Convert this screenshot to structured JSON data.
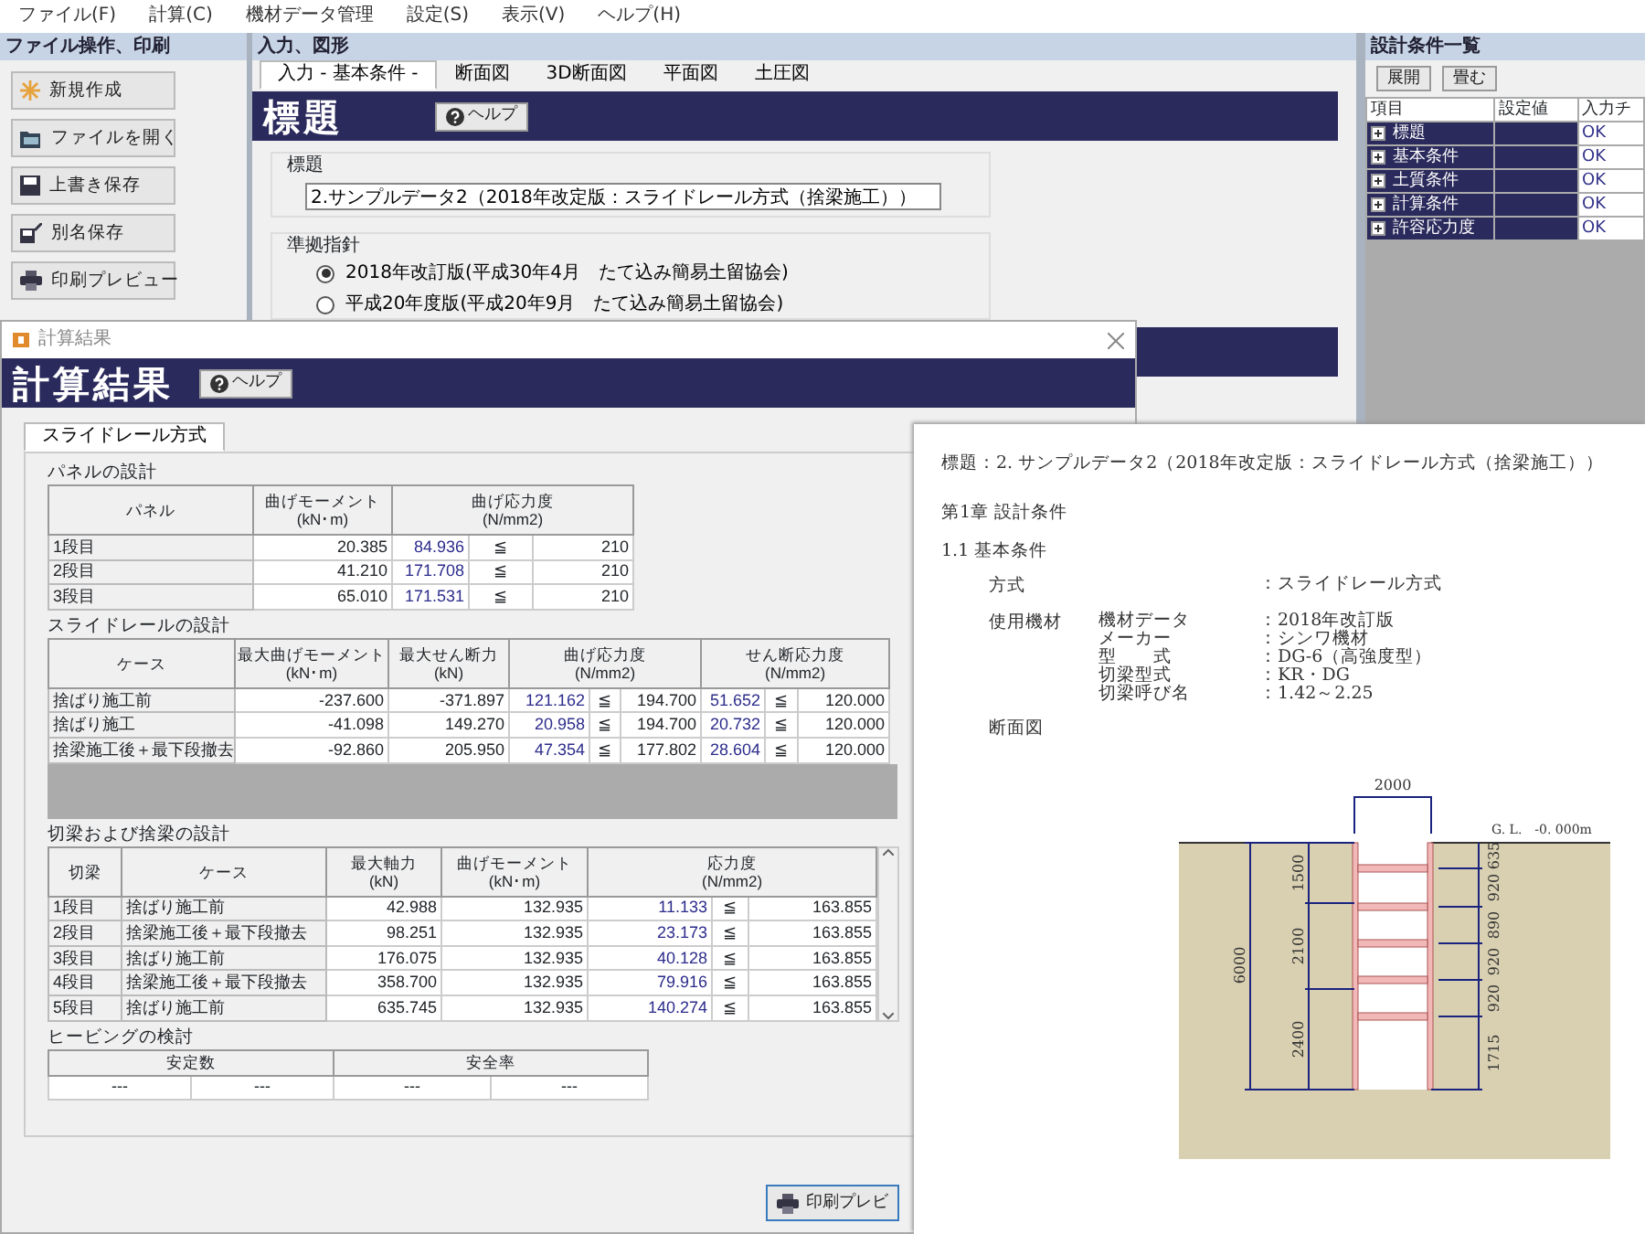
{
  "menu": [
    "ファイル(F)",
    "計算(C)",
    "機材データ管理",
    "設定(S)",
    "表示(V)",
    "ヘルプ(H)"
  ],
  "file_panel": {
    "title": "ファイル操作、印刷",
    "buttons": [
      {
        "label": "新規作成",
        "kind": "new"
      },
      {
        "label": "ファイルを開く",
        "kind": "open"
      },
      {
        "label": "上書き保存",
        "kind": "save"
      },
      {
        "label": "別名保存",
        "kind": "saveas"
      },
      {
        "label": "印刷プレビュー",
        "kind": "print"
      }
    ]
  },
  "input_panel": {
    "title": "入力、図形",
    "tabs": [
      {
        "label": "入力 - 基本条件 -",
        "selected": true
      },
      {
        "label": "断面図",
        "selected": false
      },
      {
        "label": "3D断面図",
        "selected": false
      },
      {
        "label": "平面図",
        "selected": false
      },
      {
        "label": "土圧図",
        "selected": false
      }
    ],
    "banner": {
      "title": "標題",
      "help": "ヘルプ"
    },
    "title_group": {
      "label": "標題",
      "value": "2.サンプルデータ2（2018年改定版：スライドレール方式（捨梁施工））"
    },
    "standard_group": {
      "label": "準拠指針",
      "options": [
        {
          "label": "2018年改訂版(平成30年4月　たて込み簡易土留協会)",
          "selected": true
        },
        {
          "label": "平成20年度版(平成20年9月　たて込み簡易土留協会)",
          "selected": false
        }
      ]
    }
  },
  "conditions_panel": {
    "title": "設計条件一覧",
    "buttons": [
      "展開",
      "畳む"
    ],
    "columns": [
      "項目",
      "設定値",
      "入力チ"
    ],
    "rows": [
      {
        "item": "標題",
        "check": "OK"
      },
      {
        "item": "基本条件",
        "check": "OK"
      },
      {
        "item": "土質条件",
        "check": "OK"
      },
      {
        "item": "計算条件",
        "check": "OK"
      },
      {
        "item": "許容応力度",
        "check": "OK"
      }
    ]
  },
  "result_dialog": {
    "window_title": "計算結果",
    "banner": {
      "title": "計算結果",
      "help": "ヘルプ"
    },
    "tabs": [
      {
        "label": "スライドレール方式",
        "selected": true
      }
    ],
    "panel_design": {
      "title": "パネルの設計",
      "columns": [
        {
          "label": "パネル"
        },
        {
          "label": "曲げモーメント",
          "unit": "(kN･m)"
        },
        {
          "label": "曲げ応力度",
          "unit": "(N/mm2)"
        }
      ],
      "rows": [
        {
          "name": "1段目",
          "moment": "20.385",
          "stress": "84.936",
          "op": "≦",
          "allow": "210"
        },
        {
          "name": "2段目",
          "moment": "41.210",
          "stress": "171.708",
          "op": "≦",
          "allow": "210"
        },
        {
          "name": "3段目",
          "moment": "65.010",
          "stress": "171.531",
          "op": "≦",
          "allow": "210"
        }
      ]
    },
    "rail_design": {
      "title": "スライドレールの設計",
      "columns": [
        {
          "label": "ケース"
        },
        {
          "label": "最大曲げモーメント",
          "unit": "(kN･m)"
        },
        {
          "label": "最大せん断力",
          "unit": "(kN)"
        },
        {
          "label": "曲げ応力度",
          "unit": "(N/mm2)"
        },
        {
          "label": "せん断応力度",
          "unit": "(N/mm2)"
        }
      ],
      "rows": [
        {
          "case": "捨ばり施工前",
          "moment": "-237.600",
          "shear": "-371.897",
          "bend": "121.162",
          "bend_op": "≦",
          "bend_allow": "194.700",
          "shear_stress": "51.652",
          "shear_op": "≦",
          "shear_allow": "120.000"
        },
        {
          "case": "捨ばり施工",
          "moment": "-41.098",
          "shear": "149.270",
          "bend": "20.958",
          "bend_op": "≦",
          "bend_allow": "194.700",
          "shear_stress": "20.732",
          "shear_op": "≦",
          "shear_allow": "120.000"
        },
        {
          "case": "捨梁施工後＋最下段撤去",
          "moment": "-92.860",
          "shear": "205.950",
          "bend": "47.354",
          "bend_op": "≦",
          "bend_allow": "177.802",
          "shear_stress": "28.604",
          "shear_op": "≦",
          "shear_allow": "120.000"
        }
      ]
    },
    "strut_design": {
      "title": "切梁および捨梁の設計",
      "columns": [
        {
          "label": "切梁"
        },
        {
          "label": "ケース"
        },
        {
          "label": "最大軸力",
          "unit": "(kN)"
        },
        {
          "label": "曲げモーメント",
          "unit": "(kN･m)"
        },
        {
          "label": "応力度",
          "unit": "(N/mm2)"
        }
      ],
      "rows": [
        {
          "stage": "1段目",
          "case": "捨ばり施工前",
          "axial": "42.988",
          "moment": "132.935",
          "stress": "11.133",
          "op": "≦",
          "allow": "163.855"
        },
        {
          "stage": "2段目",
          "case": "捨梁施工後＋最下段撤去",
          "axial": "98.251",
          "moment": "132.935",
          "stress": "23.173",
          "op": "≦",
          "allow": "163.855"
        },
        {
          "stage": "3段目",
          "case": "捨ばり施工前",
          "axial": "176.075",
          "moment": "132.935",
          "stress": "40.128",
          "op": "≦",
          "allow": "163.855"
        },
        {
          "stage": "4段目",
          "case": "捨梁施工後＋最下段撤去",
          "axial": "358.700",
          "moment": "132.935",
          "stress": "79.916",
          "op": "≦",
          "allow": "163.855"
        },
        {
          "stage": "5段目",
          "case": "捨ばり施工前",
          "axial": "635.745",
          "moment": "132.935",
          "stress": "140.274",
          "op": "≦",
          "allow": "163.855"
        }
      ]
    },
    "heaving": {
      "title": "ヒービングの検討",
      "columns": [
        "安定数",
        "安全率"
      ],
      "values": [
        "---",
        "---",
        "---",
        "---"
      ]
    },
    "print_button": "印刷プレビ"
  },
  "report": {
    "title": "標題：2. サンプルデータ2（2018年改定版：スライドレール方式（捨梁施工））",
    "chapter": "第1章 設計条件",
    "section": "1.1 基本条件",
    "conditions": [
      {
        "label": "方式",
        "rows": [
          {
            "value": "：スライドレール方式"
          }
        ]
      },
      {
        "label": "使用機材",
        "rows": [
          {
            "key": "機材データ",
            "value": "：2018年改訂版"
          },
          {
            "key": "メーカー",
            "value": "：シンワ機材"
          },
          {
            "key": "型　　式",
            "value": "：DG-6（高強度型）"
          },
          {
            "key": "切梁型式",
            "value": "：KR・DG"
          },
          {
            "key": "切梁呼び名",
            "value": "：1.42～2.25"
          }
        ]
      }
    ],
    "figure_title": "断面図",
    "drawing": {
      "width_label": "2000",
      "gl_label": "G. L.　-0. 000m",
      "total_depth": "6000",
      "left_dims": [
        "1500",
        "2100",
        "2400"
      ],
      "right_dims": [
        "635",
        "920",
        "890",
        "920",
        "920",
        "1715"
      ]
    }
  }
}
